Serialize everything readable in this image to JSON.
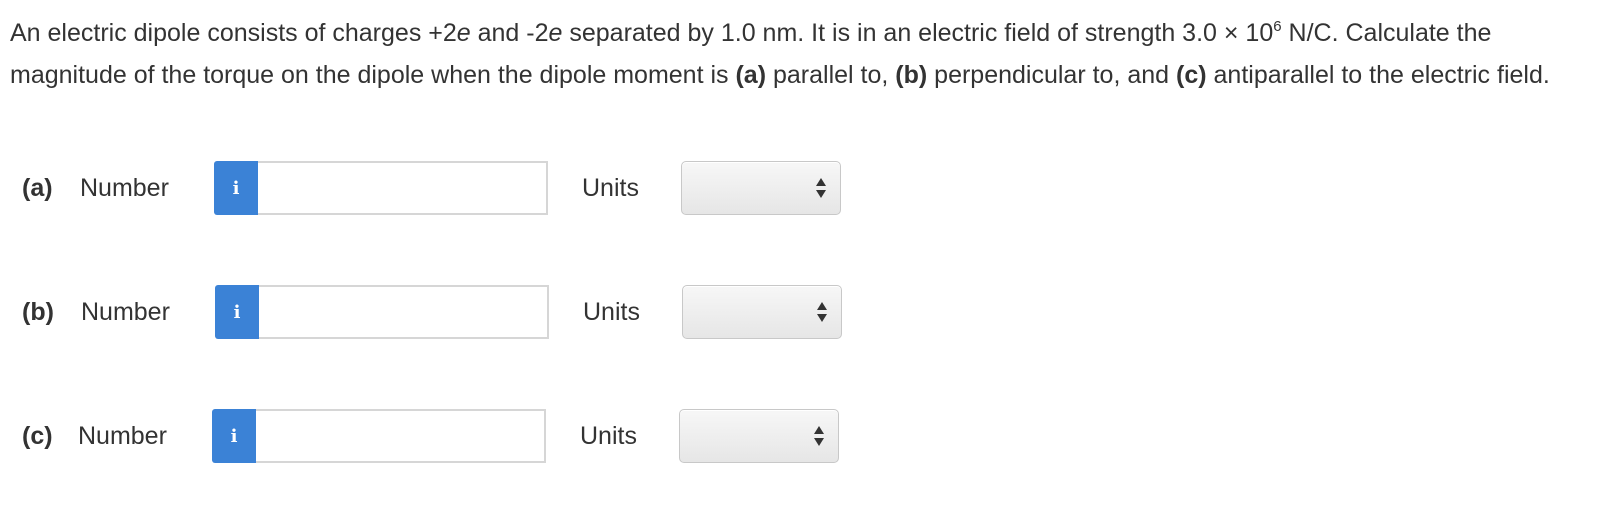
{
  "question": {
    "text1": "An electric dipole consists of charges +2",
    "e1": "e",
    "text2": " and -2",
    "e2": "e",
    "text3": " separated by 1.0 nm. It is in an electric field of strength 3.0 × 10",
    "exp": "6",
    "text4": " N/C. Calculate the magnitude of the torque on the dipole when the dipole moment is ",
    "a": "(a)",
    "text5": " parallel to, ",
    "b": "(b)",
    "text6": " perpendicular to, and ",
    "c": "(c)",
    "text7": " antiparallel to the electric field."
  },
  "parts": [
    {
      "label": "(a)",
      "number_label": "Number",
      "info": "i",
      "value": "",
      "units_label": "Units",
      "units_value": ""
    },
    {
      "label": "(b)",
      "number_label": "Number",
      "info": "i",
      "value": "",
      "units_label": "Units",
      "units_value": ""
    },
    {
      "label": "(c)",
      "number_label": "Number",
      "info": "i",
      "value": "",
      "units_label": "Units",
      "units_value": ""
    }
  ],
  "colors": {
    "info_button": "#3b82d6",
    "text": "#333333"
  }
}
